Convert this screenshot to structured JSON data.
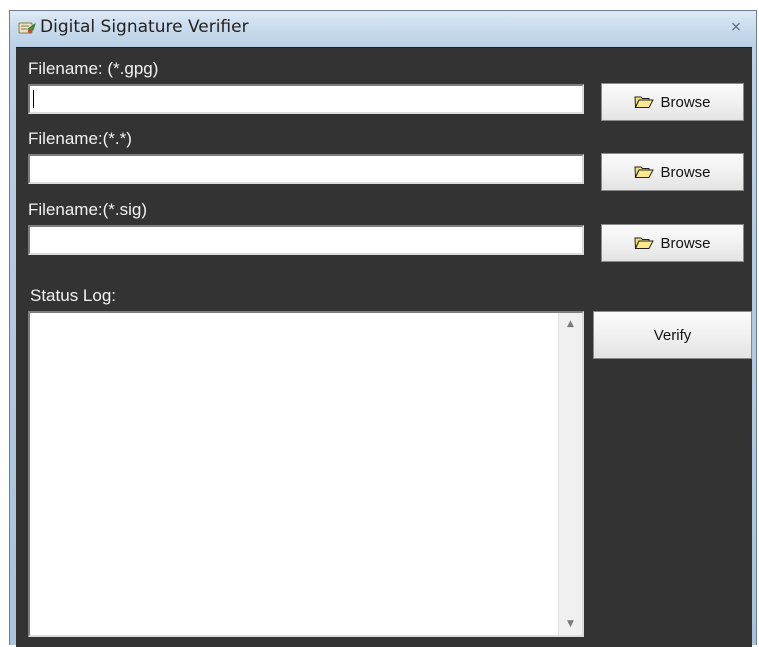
{
  "window": {
    "title": "Digital Signature Verifier",
    "close_glyph": "⨯"
  },
  "fields": [
    {
      "label": "Filename: (*.gpg)",
      "value": "",
      "button_label": "Browse"
    },
    {
      "label": "Filename:(*.*)",
      "value": "",
      "button_label": "Browse"
    },
    {
      "label": "Filename:(*.sig)",
      "value": "",
      "button_label": "Browse"
    }
  ],
  "status_log": {
    "label": "Status Log:",
    "content": ""
  },
  "verify_button": {
    "label": "Verify"
  },
  "icons": {
    "title_icon": "certificate-icon",
    "browse_icon": "folder-open-icon",
    "scroll_up": "scroll-up-arrow-icon",
    "scroll_down": "scroll-down-arrow-icon"
  },
  "colors": {
    "client_background": "#333333",
    "label_text": "#f2f2f2",
    "titlebar": "#c9dbec"
  }
}
